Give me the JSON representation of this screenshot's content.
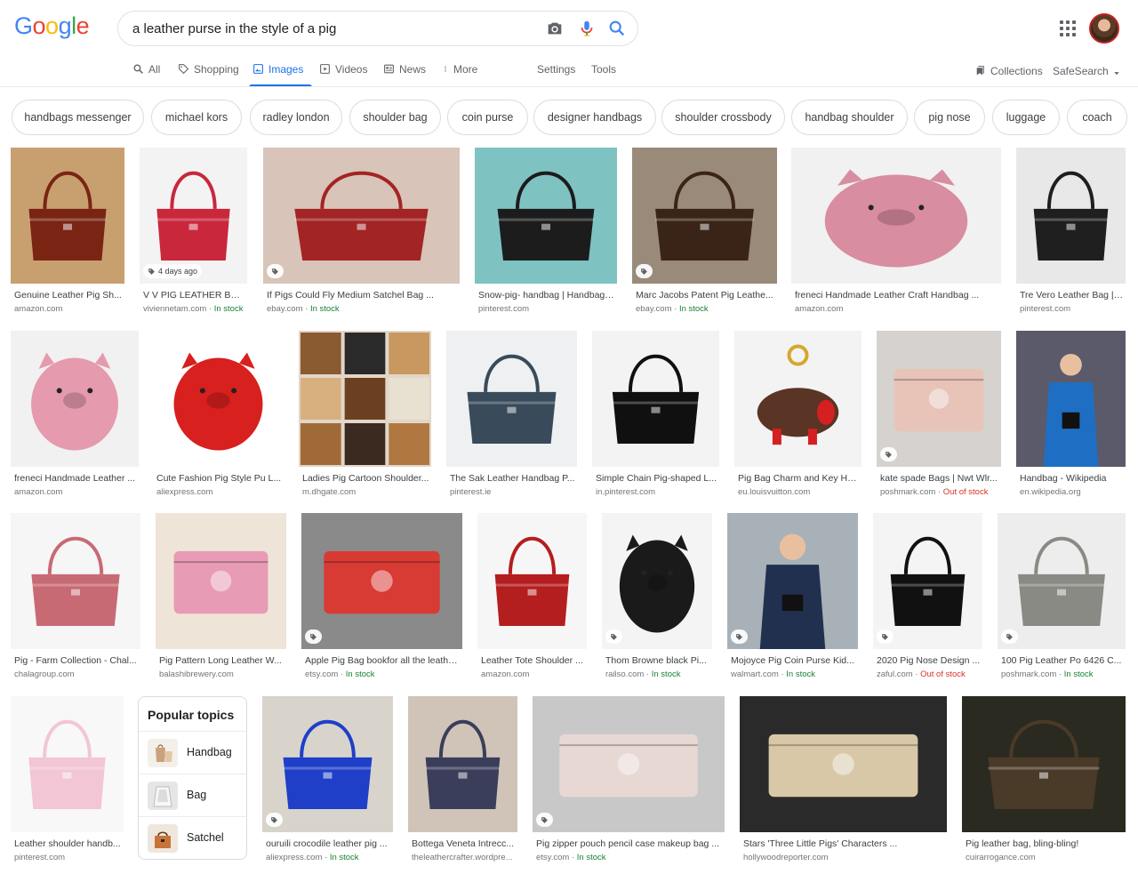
{
  "header": {
    "logo_letters": [
      {
        "ch": "G",
        "color": "#4285f4"
      },
      {
        "ch": "o",
        "color": "#ea4335"
      },
      {
        "ch": "o",
        "color": "#fbbc05"
      },
      {
        "ch": "g",
        "color": "#4285f4"
      },
      {
        "ch": "l",
        "color": "#34a853"
      },
      {
        "ch": "e",
        "color": "#ea4335"
      }
    ],
    "search_query": "a leather purse in the style of a pig",
    "icons": [
      "camera-icon",
      "microphone-icon",
      "search-icon",
      "apps-icon",
      "avatar"
    ]
  },
  "tabs": {
    "all": "All",
    "shopping": "Shopping",
    "images": "Images",
    "videos": "Videos",
    "news": "News",
    "more": "More",
    "settings": "Settings",
    "tools": "Tools",
    "collections": "Collections",
    "safesearch": "SafeSearch"
  },
  "chips": [
    "handbags messenger",
    "michael kors",
    "radley london",
    "shoulder bag",
    "coin purse",
    "designer handbags",
    "shoulder crossbody",
    "handbag shoulder",
    "pig nose",
    "luggage",
    "coach"
  ],
  "results": [
    {
      "title": "Genuine Leather Pig Sh...",
      "source": "amazon.com",
      "stock": ""
    },
    {
      "title": "V V PIG LEATHER BAG ...",
      "source": "viviennetam.com",
      "stock": "In stock",
      "badge": "4 days ago"
    },
    {
      "title": "If Pigs Could Fly Medium Satchel Bag ...",
      "source": "ebay.com",
      "stock": "In stock"
    },
    {
      "title": "Snow-pig- handbag | Handbag, ...",
      "source": "pinterest.com",
      "stock": ""
    },
    {
      "title": "Marc Jacobs Patent Pig Leathe...",
      "source": "ebay.com",
      "stock": "In stock"
    },
    {
      "title": "freneci Handmade Leather Craft Handbag ...",
      "source": "amazon.com",
      "stock": ""
    },
    {
      "title": "Tre Vero Leather Bag | ...",
      "source": "pinterest.com",
      "stock": ""
    },
    {
      "title": "freneci Handmade Leather ...",
      "source": "amazon.com",
      "stock": ""
    },
    {
      "title": "Cute Fashion Pig Style Pu L...",
      "source": "aliexpress.com",
      "stock": ""
    },
    {
      "title": "Ladies Pig Cartoon Shoulder...",
      "source": "m.dhgate.com",
      "stock": ""
    },
    {
      "title": "The Sak Leather Handbag P...",
      "source": "pinterest.ie",
      "stock": ""
    },
    {
      "title": "Simple Chain Pig-shaped L...",
      "source": "in.pinterest.com",
      "stock": ""
    },
    {
      "title": "Pig Bag Charm and Key Hol...",
      "source": "eu.louisvuitton.com",
      "stock": ""
    },
    {
      "title": "kate spade Bags | Nwt Wlr...",
      "source": "poshmark.com",
      "stock": "Out of stock"
    },
    {
      "title": "Handbag - Wikipedia",
      "source": "en.wikipedia.org",
      "stock": ""
    },
    {
      "title": "Pig - Farm Collection - Chal...",
      "source": "chalagroup.com",
      "stock": ""
    },
    {
      "title": "Pig Pattern Long Leather W...",
      "source": "balashibrewery.com",
      "stock": ""
    },
    {
      "title": "Apple Pig Bag bookfor all the leathe...",
      "source": "etsy.com",
      "stock": "In stock"
    },
    {
      "title": "Leather Tote Shoulder ...",
      "source": "amazon.com",
      "stock": ""
    },
    {
      "title": "Thom Browne black Pi...",
      "source": "railso.com",
      "stock": "In stock"
    },
    {
      "title": "Mojoyce Pig Coin Purse Kid...",
      "source": "walmart.com",
      "stock": "In stock"
    },
    {
      "title": "2020 Pig Nose Design ...",
      "source": "zaful.com",
      "stock": "Out of stock"
    },
    {
      "title": "100 Pig Leather Po 6426 C...",
      "source": "poshmark.com",
      "stock": "In stock"
    },
    {
      "title": "Leather shoulder handb...",
      "source": "pinterest.com",
      "stock": ""
    },
    {
      "title": "ouruili crocodile leather pig ...",
      "source": "aliexpress.com",
      "stock": "In stock"
    },
    {
      "title": "Bottega Veneta Intrecc...",
      "source": "theleathercrafter.wordpre...",
      "stock": ""
    },
    {
      "title": "Pig zipper pouch pencil case makeup bag ...",
      "source": "etsy.com",
      "stock": "In stock"
    },
    {
      "title": "Stars 'Three Little Pigs' Characters ...",
      "source": "hollywoodreporter.com",
      "stock": ""
    },
    {
      "title": "Pig leather bag, bling-bling!",
      "source": "cuirarrogance.com",
      "stock": ""
    }
  ],
  "popular_topics": {
    "title": "Popular topics",
    "items": [
      "Handbag",
      "Bag",
      "Satchel"
    ]
  }
}
